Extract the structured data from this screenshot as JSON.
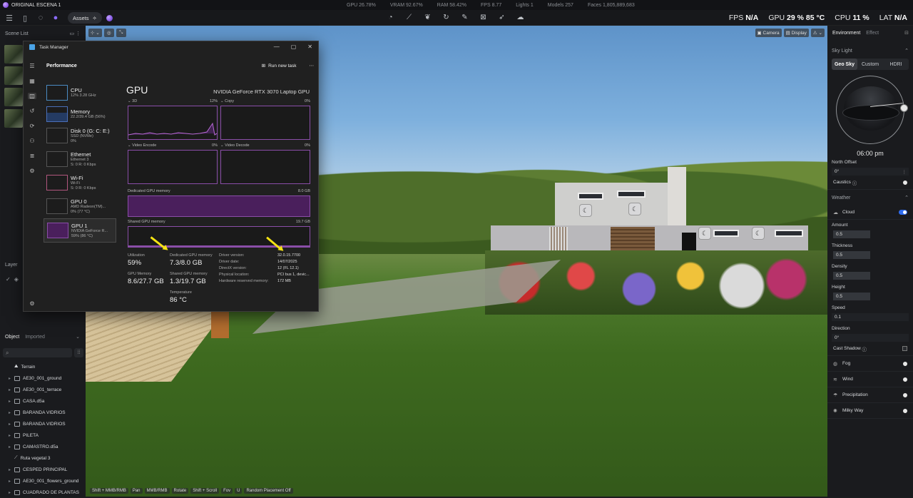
{
  "titlebar": {
    "app_name": "ORIGINAL ESCENA 1",
    "stats": [
      "GPU 26.78%",
      "VRAM 92.67%",
      "RAM 58.42%",
      "FPS 8.77",
      "Lights 1",
      "Models 257",
      "Faces 1,805,889,683"
    ]
  },
  "toolbar": {
    "assets_label": "Assets",
    "metrics": {
      "fps_label": "FPS",
      "fps_value": "N/A",
      "gpu_label": "GPU",
      "gpu_value": "29 %  85 °C",
      "cpu_label": "CPU",
      "cpu_value": "11 %",
      "lat_label": "LAT",
      "lat_value": "N/A"
    }
  },
  "scene_list": {
    "title": "Scene List"
  },
  "layer": {
    "title": "Layer"
  },
  "object_panel": {
    "tab_object": "Object",
    "tab_imported": "Imported",
    "items": [
      "Terrain",
      "AE30_001_ground",
      "AE30_001_terrace",
      "CASA.d5a",
      "BARANDA VIDRIOS",
      "BARANDA VIDRIOS",
      "PILETA",
      "CAMASTRO.d5a",
      "Ruta vegetal 3",
      "CESPED PRINCIPAL",
      "AE30_001_flowers_ground",
      "CUADRADO DE PLANTAS"
    ]
  },
  "viewport": {
    "camera_label": "Camera",
    "display_label": "Display",
    "hints": [
      "Shift + MMB/RMB",
      "Pan",
      "MMB/RMB",
      "Rotate",
      "Shift + Scroll",
      "Fov",
      "U",
      "Random Placement Off"
    ]
  },
  "right_panel": {
    "tab_environment": "Environment",
    "tab_effect": "Effect",
    "sky_light": "Sky Light",
    "sky_modes": [
      "Geo Sky",
      "Custom",
      "HDRI"
    ],
    "time": "06:00 pm",
    "north_offset_label": "North Offset",
    "north_offset_value": "0°",
    "caustics_label": "Caustics",
    "weather_label": "Weather",
    "cloud_label": "Cloud",
    "amount_label": "Amount",
    "amount_value": "0.5",
    "thickness_label": "Thickness",
    "thickness_value": "0.5",
    "density_label": "Density",
    "density_value": "0.5",
    "height_label": "Height",
    "height_value": "0.5",
    "speed_label": "Speed",
    "speed_value": "0.1",
    "direction_label": "Direction",
    "direction_value": "0°",
    "cast_shadow_label": "Cast Shadow",
    "fog_label": "Fog",
    "wind_label": "Wind",
    "precipitation_label": "Precipitation",
    "milky_way_label": "Milky Way"
  },
  "task_manager": {
    "title": "Task Manager",
    "section": "Performance",
    "run_new_task": "Run new task",
    "processes": [
      {
        "name": "CPU",
        "sub": "12%  3.28 GHz"
      },
      {
        "name": "Memory",
        "sub": "22.2/39.4 GB (56%)"
      },
      {
        "name": "Disk 0 (G: C: E:)",
        "sub": "SSD (NVMe)",
        "sub2": "0%"
      },
      {
        "name": "Ethernet",
        "sub": "Ethernet 3",
        "sub2": "S: 0  R: 0 Kbps"
      },
      {
        "name": "Wi-Fi",
        "sub": "Wi-Fi",
        "sub2": "S: 0  R: 0 Kbps"
      },
      {
        "name": "GPU 0",
        "sub": "AMD Radeon(TM)...",
        "sub2": "0% (77 °C)"
      },
      {
        "name": "GPU 1",
        "sub": "NVIDIA GeForce R...",
        "sub2": "59% (86 °C)"
      }
    ],
    "gpu_title": "GPU",
    "gpu_model": "NVIDIA GeForce RTX 3070 Laptop GPU",
    "graphs": {
      "g3d": "3D",
      "g3d_pct": "12%",
      "copy": "Copy",
      "copy_pct": "0%",
      "venc": "Video Encode",
      "venc_pct": "0%",
      "vdec": "Video Decode",
      "vdec_pct": "0%",
      "dedicated": "Dedicated GPU memory",
      "dedicated_max": "8.0 GB",
      "shared": "Shared GPU memory",
      "shared_max": "19.7 GB"
    },
    "stats": {
      "utilization_label": "Utilization",
      "utilization": "59%",
      "dedicated_label": "Dedicated GPU memory",
      "dedicated": "7.3/8.0 GB",
      "gpu_memory_label": "GPU Memory",
      "gpu_memory": "8.6/27.7 GB",
      "shared_label": "Shared GPU memory",
      "shared": "1.3/19.7 GB",
      "temperature_label": "Temperature",
      "temperature": "86 °C"
    },
    "driver": {
      "version_label": "Driver version:",
      "version": "32.0.15.7700",
      "date_label": "Driver date:",
      "date": "14/07/2025",
      "directx_label": "DirectX version:",
      "directx": "12 (FL 12.1)",
      "location_label": "Physical location:",
      "location": "PCI bus 1, devic...",
      "reserved_label": "Hardware reserved memory:",
      "reserved": "172 MB"
    }
  },
  "colors": {
    "accent": "#2e6cf0",
    "gpu_graph": "#8a4ea8",
    "annotation_arrow": "#f5e313"
  }
}
